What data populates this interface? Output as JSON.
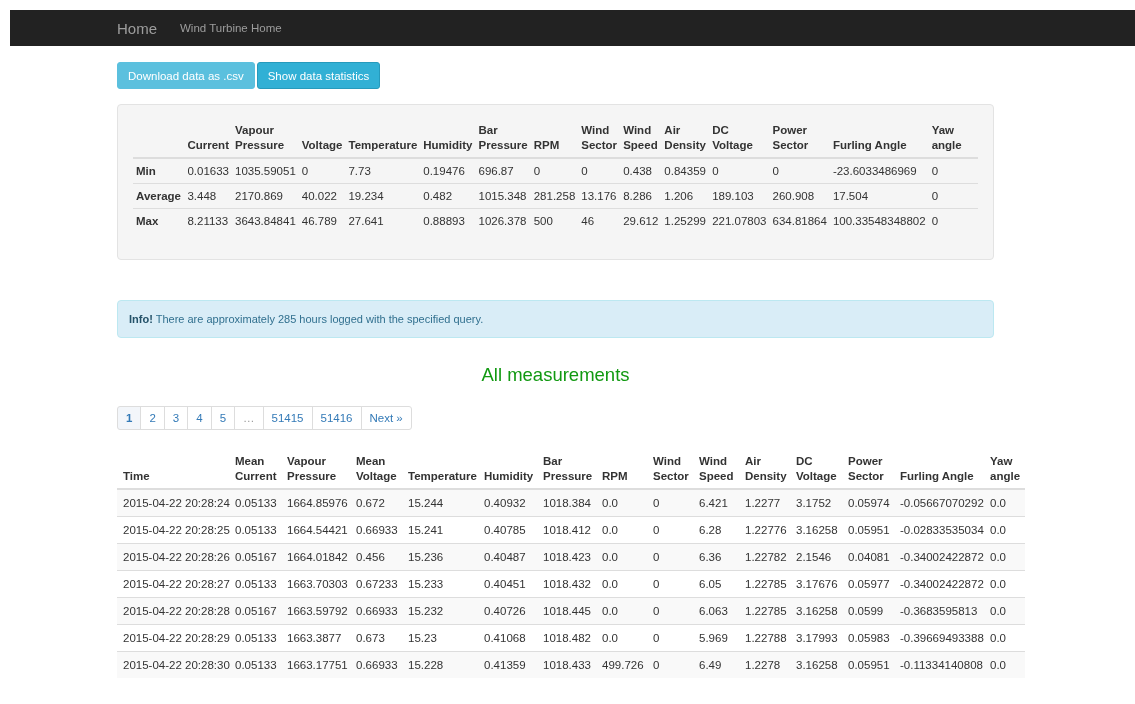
{
  "navbar": {
    "brand": "Home",
    "links": [
      "Wind Turbine Home"
    ]
  },
  "buttons": [
    {
      "label": "Download data as .csv",
      "active": false
    },
    {
      "label": "Show data statistics",
      "active": true
    }
  ],
  "statistics": {
    "columns": [
      "",
      "Current",
      "Vapour Pressure",
      "Voltage",
      "Temperature",
      "Humidity",
      "Bar Pressure",
      "RPM",
      "Wind Sector",
      "Wind Speed",
      "Air Density",
      "DC Voltage",
      "Power Sector",
      "Furling Angle",
      "Yaw angle"
    ],
    "rows": [
      {
        "label": "Min",
        "values": [
          "0.01633",
          "1035.59051",
          "0",
          "7.73",
          "0.19476",
          "696.87",
          "0",
          "0",
          "0.438",
          "0.84359",
          "0",
          "0",
          "-23.6033486969",
          "0"
        ]
      },
      {
        "label": "Average",
        "values": [
          "3.448",
          "2170.869",
          "40.022",
          "19.234",
          "0.482",
          "1015.348",
          "281.258",
          "13.176",
          "8.286",
          "1.206",
          "189.103",
          "260.908",
          "17.504",
          "0"
        ]
      },
      {
        "label": "Max",
        "values": [
          "8.21133",
          "3643.84841",
          "46.789",
          "27.641",
          "0.88893",
          "1026.378",
          "500",
          "46",
          "29.612",
          "1.25299",
          "221.07803",
          "634.81864",
          "100.33548348802",
          "0"
        ]
      }
    ]
  },
  "info_alert": "**Info!** There are approximately 285 hours logged with the specified query.",
  "heading": "All measurements",
  "pagination": [
    {
      "label": "1",
      "selected": true,
      "disabled": false
    },
    {
      "label": "2",
      "selected": false,
      "disabled": false
    },
    {
      "label": "3",
      "selected": false,
      "disabled": false
    },
    {
      "label": "4",
      "selected": false,
      "disabled": false
    },
    {
      "label": "5",
      "selected": false,
      "disabled": false
    },
    {
      "label": "…",
      "selected": false,
      "disabled": true
    },
    {
      "label": "51415",
      "selected": false,
      "disabled": false
    },
    {
      "label": "51416",
      "selected": false,
      "disabled": false
    },
    {
      "label": "Next »",
      "selected": false,
      "disabled": false
    }
  ],
  "measurements": {
    "columns": [
      "Time",
      "Mean Current",
      "Vapour Pressure",
      "Mean Voltage",
      "Temperature",
      "Humidity",
      "Bar Pressure",
      "RPM",
      "Wind Sector",
      "Wind Speed",
      "Air Density",
      "DC Voltage",
      "Power Sector",
      "Furling Angle",
      "Yaw angle"
    ],
    "rows": [
      [
        "2015-04-22 20:28:24",
        "0.05133",
        "1664.85976",
        "0.672",
        "15.244",
        "0.40932",
        "1018.384",
        "0.0",
        "0",
        "6.421",
        "1.2277",
        "3.1752",
        "0.05974",
        "-0.05667070292",
        "0.0"
      ],
      [
        "2015-04-22 20:28:25",
        "0.05133",
        "1664.54421",
        "0.66933",
        "15.241",
        "0.40785",
        "1018.412",
        "0.0",
        "0",
        "6.28",
        "1.22776",
        "3.16258",
        "0.05951",
        "-0.02833535034",
        "0.0"
      ],
      [
        "2015-04-22 20:28:26",
        "0.05167",
        "1664.01842",
        "0.456",
        "15.236",
        "0.40487",
        "1018.423",
        "0.0",
        "0",
        "6.36",
        "1.22782",
        "2.1546",
        "0.04081",
        "-0.34002422872",
        "0.0"
      ],
      [
        "2015-04-22 20:28:27",
        "0.05133",
        "1663.70303",
        "0.67233",
        "15.233",
        "0.40451",
        "1018.432",
        "0.0",
        "0",
        "6.05",
        "1.22785",
        "3.17676",
        "0.05977",
        "-0.34002422872",
        "0.0"
      ],
      [
        "2015-04-22 20:28:28",
        "0.05167",
        "1663.59792",
        "0.66933",
        "15.232",
        "0.40726",
        "1018.445",
        "0.0",
        "0",
        "6.063",
        "1.22785",
        "3.16258",
        "0.0599",
        "-0.3683595813",
        "0.0"
      ],
      [
        "2015-04-22 20:28:29",
        "0.05133",
        "1663.3877",
        "0.673",
        "15.23",
        "0.41068",
        "1018.482",
        "0.0",
        "0",
        "5.969",
        "1.22788",
        "3.17993",
        "0.05983",
        "-0.39669493388",
        "0.0"
      ],
      [
        "2015-04-22 20:28:30",
        "0.05133",
        "1663.17751",
        "0.66933",
        "15.228",
        "0.41359",
        "1018.433",
        "499.726",
        "0",
        "6.49",
        "1.2278",
        "3.16258",
        "0.05951",
        "-0.11334140808",
        "0.0"
      ]
    ]
  }
}
